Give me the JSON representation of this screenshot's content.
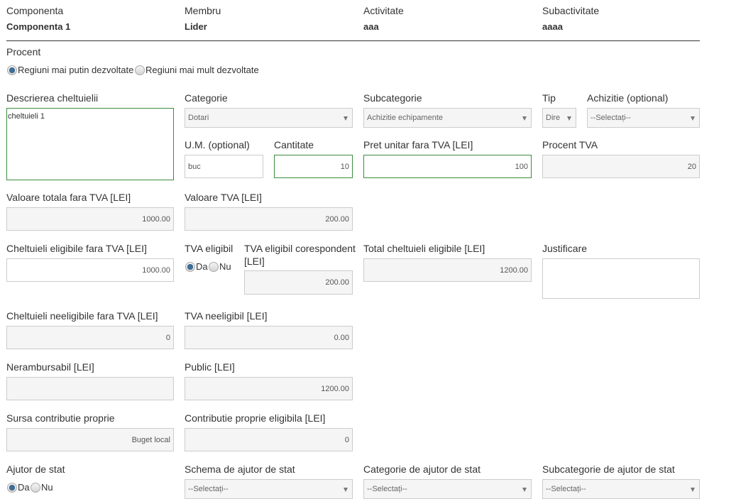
{
  "summary": {
    "componenta_label": "Componenta",
    "componenta_value": "Componenta 1",
    "membru_label": "Membru",
    "membru_value": "Lider",
    "activitate_label": "Activitate",
    "activitate_value": "aaa",
    "subactivitate_label": "Subactivitate",
    "subactivitate_value": "aaaa"
  },
  "procent": {
    "label": "Procent",
    "options": [
      "Regiuni mai putin dezvoltate",
      "Regiuni mai mult dezvoltate"
    ],
    "selected_index": 0
  },
  "descriere": {
    "label": "Descrierea cheltuielii",
    "value": "cheltuieli 1"
  },
  "categorie": {
    "label": "Categorie",
    "selected": "Dotari"
  },
  "subcategorie": {
    "label": "Subcategorie",
    "selected": "Achizitie echipamente"
  },
  "tip": {
    "label": "Tip",
    "selected": "Dire"
  },
  "achizitie": {
    "label": "Achizitie (optional)",
    "selected": "--Selectați--"
  },
  "um": {
    "label": "U.M. (optional)",
    "value": "buc"
  },
  "cantitate": {
    "label": "Cantitate",
    "value": "10"
  },
  "pret_unitar": {
    "label": "Pret unitar fara TVA [LEI]",
    "value": "100"
  },
  "procent_tva": {
    "label": "Procent TVA",
    "value": "20"
  },
  "valoare_totala": {
    "label": "Valoare totala fara TVA [LEI]",
    "value": "1000.00"
  },
  "valoare_tva": {
    "label": "Valoare TVA [LEI]",
    "value": "200.00"
  },
  "chelt_eligibile": {
    "label": "Cheltuieli eligibile fara TVA [LEI]",
    "value": "1000.00"
  },
  "tva_eligibil": {
    "label": "TVA eligibil",
    "options": [
      "Da",
      "Nu"
    ],
    "selected_index": 0
  },
  "tva_eligibil_coresp": {
    "label_line1": "TVA eligibil corespondent",
    "label_line2": "[LEI]",
    "value": "200.00"
  },
  "total_eligibile": {
    "label": "Total cheltuieli eligibile [LEI]",
    "value": "1200.00"
  },
  "justificare": {
    "label": "Justificare",
    "value": ""
  },
  "chelt_neeligibile": {
    "label": "Cheltuieli neeligibile fara TVA [LEI]",
    "value": "0"
  },
  "tva_neeligibil": {
    "label": "TVA neeligibil [LEI]",
    "value": "0.00"
  },
  "nerambursabil": {
    "label": "Nerambursabil [LEI]",
    "value": ""
  },
  "public": {
    "label": "Public [LEI]",
    "value": "1200.00"
  },
  "sursa": {
    "label": "Sursa contributie proprie",
    "value": "Buget local"
  },
  "contributie": {
    "label": "Contributie proprie eligibila [LEI]",
    "value": "0"
  },
  "ajutor": {
    "label": "Ajutor de stat",
    "options": [
      "Da",
      "Nu"
    ],
    "selected_index": 0
  },
  "schema": {
    "label": "Schema de ajutor de stat",
    "selected": "--Selectați--"
  },
  "cat_ajutor": {
    "label": "Categorie de ajutor de stat",
    "selected": "--Selectați--"
  },
  "subcat_ajutor": {
    "label": "Subcategorie de ajutor de stat",
    "selected": "--Selectați--"
  },
  "colors": {
    "accent_border": "#3c8c3c",
    "radio_dot": "#3d6e99"
  }
}
